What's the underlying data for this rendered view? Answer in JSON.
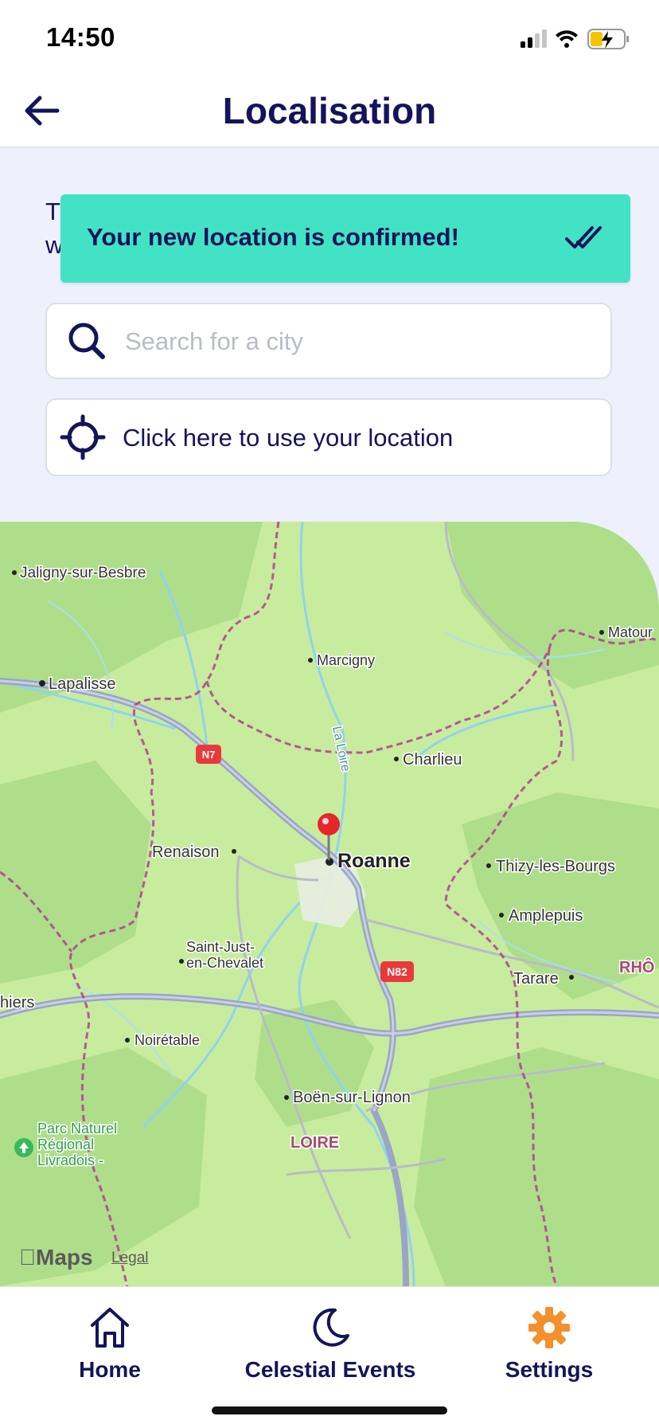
{
  "status": {
    "time": "14:50"
  },
  "header": {
    "title": "Localisation"
  },
  "intro_text": "T\nw",
  "toast": {
    "message": "Your new location is confirmed!"
  },
  "search": {
    "placeholder": "Search for a city"
  },
  "locate": {
    "label": "Click here to use your location"
  },
  "map": {
    "places": [
      "Jaligny-sur-Besbre",
      "Lapalisse",
      "Marcigny",
      "Matour",
      "Charlieu",
      "Renaison",
      "Roanne",
      "Thizy-les-Bourgs",
      "Amplepuis",
      "Saint-Just-\nen-Chevalet",
      "Tarare",
      "RHÔ",
      "hiers",
      "Noirétable",
      "Boën-sur-Lignon",
      "LOIRE",
      "Parc Naturel\nRégional\nLivradois -",
      "La Loire"
    ],
    "roads": [
      "N7",
      "N82"
    ],
    "branding": "Maps",
    "legal": "Legal"
  },
  "tabs": [
    {
      "label": "Home",
      "icon": "home-icon"
    },
    {
      "label": "Celestial Events",
      "icon": "moon-icon"
    },
    {
      "label": "Settings",
      "icon": "gear-icon",
      "active": true
    }
  ],
  "colors": {
    "primary": "#14145a",
    "toast": "#42e3c4",
    "active_tab": "#f2912e",
    "background": "#eef1fb"
  }
}
